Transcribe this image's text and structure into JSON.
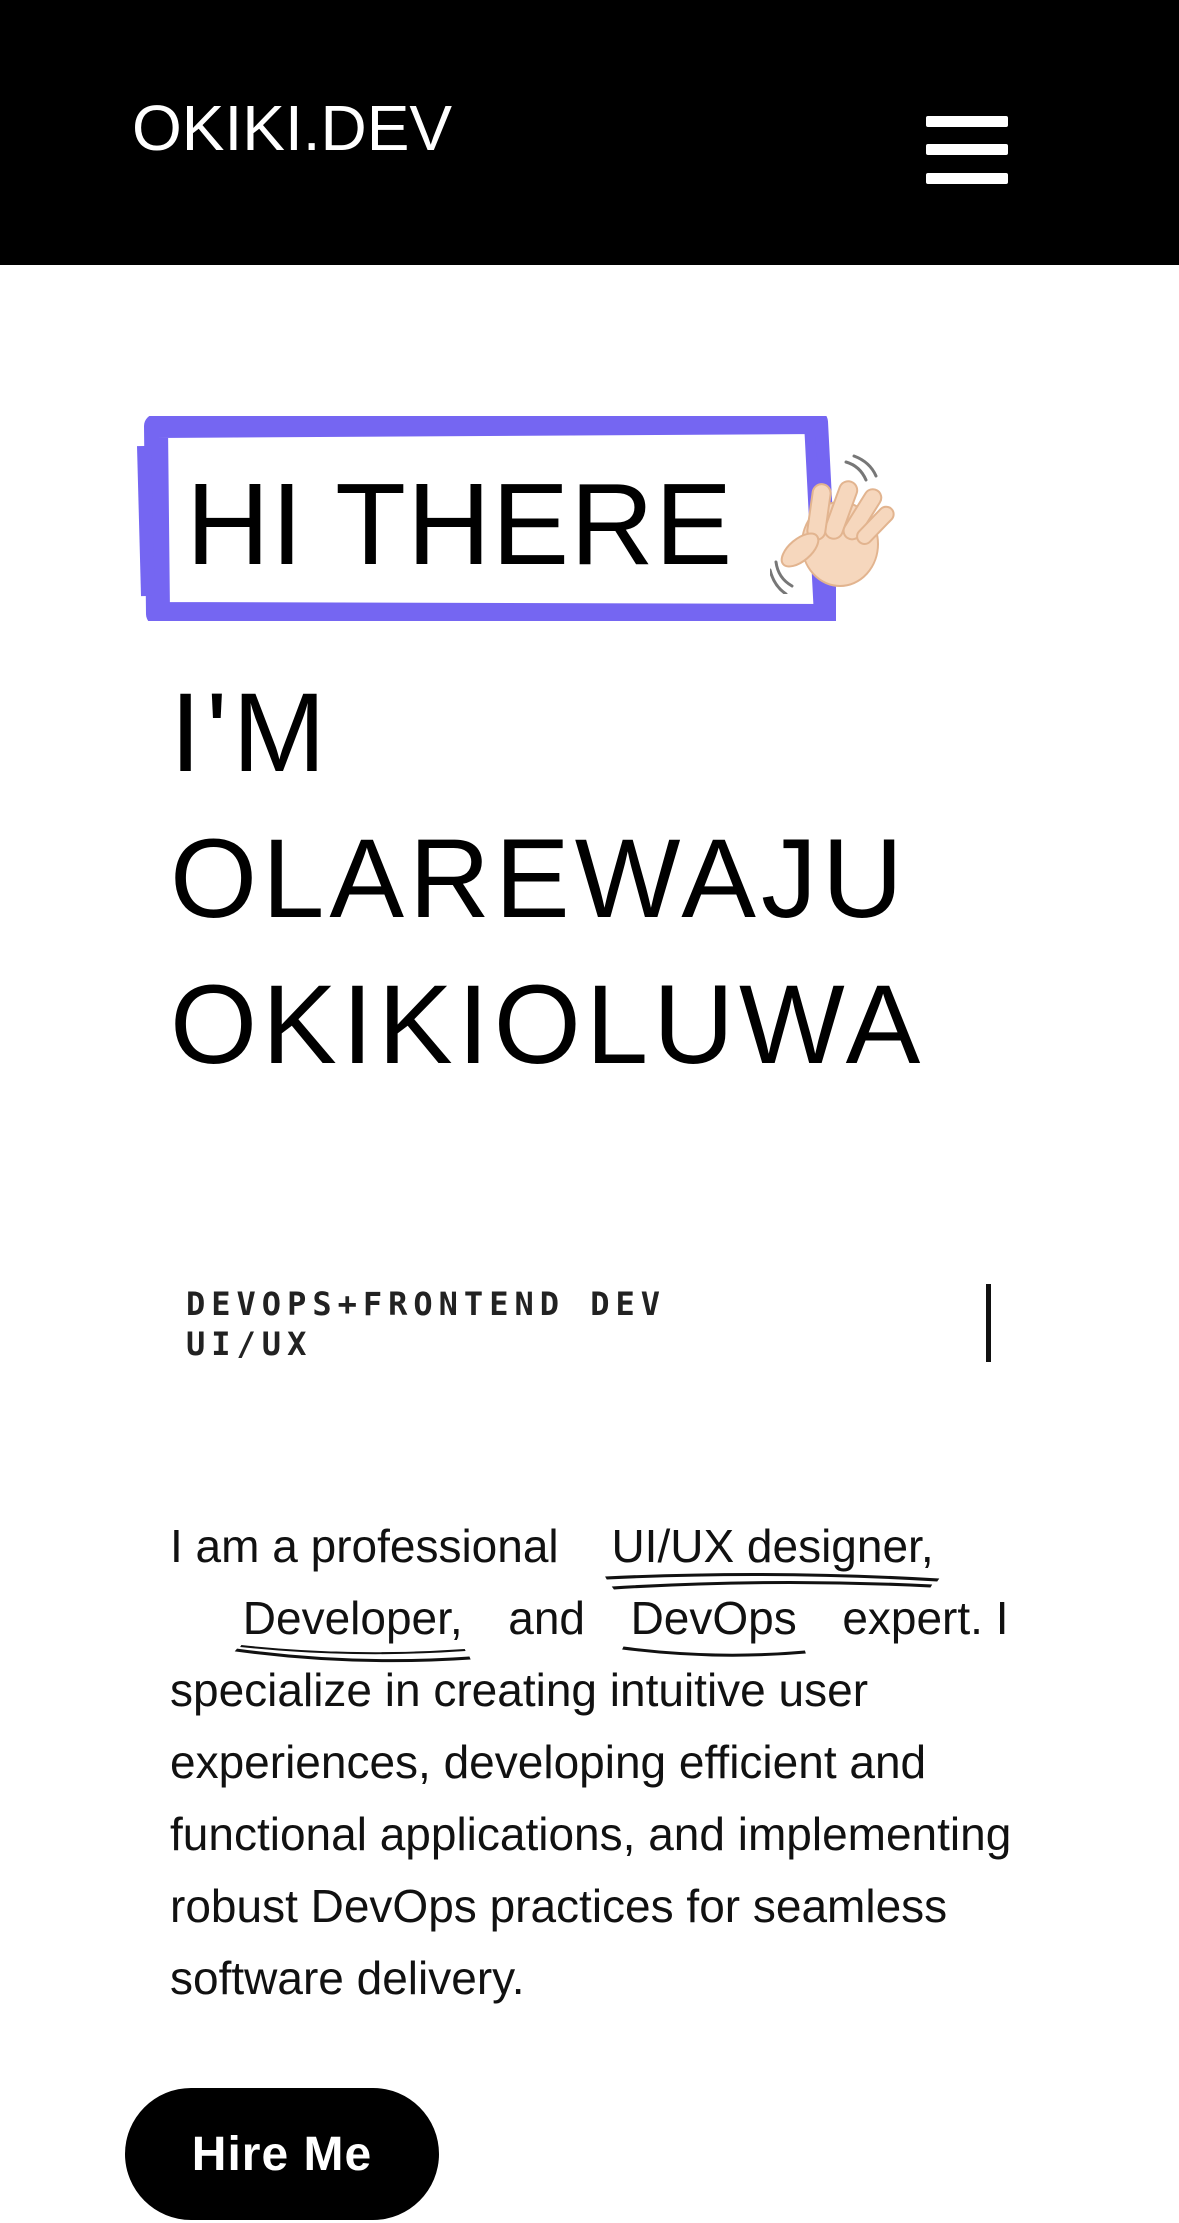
{
  "header": {
    "logo": "OKIKI.DEV",
    "menu_icon": "hamburger-menu-icon"
  },
  "hero": {
    "greeting": "HI THERE",
    "greeting_icon": "waving-hand-icon",
    "intro": "I'M",
    "name_line1": "OLAREWAJU",
    "name_line2": "OKIKIOLUWA",
    "roles_line1": "DEVOPS+FRONTEND DEV",
    "roles_line2": "UI/UX",
    "accent_color": "#7566f2"
  },
  "bio": {
    "part1": "I am a professional",
    "highlight1": "UI/UX designer,",
    "highlight2": "Developer,",
    "part2": "and",
    "highlight3": "DevOps",
    "part3": "expert. I specialize in creating intuitive user experiences, developing efficient and functional applications, and implementing robust DevOps practices for seamless software delivery."
  },
  "cta": {
    "hire_label": "Hire Me"
  }
}
